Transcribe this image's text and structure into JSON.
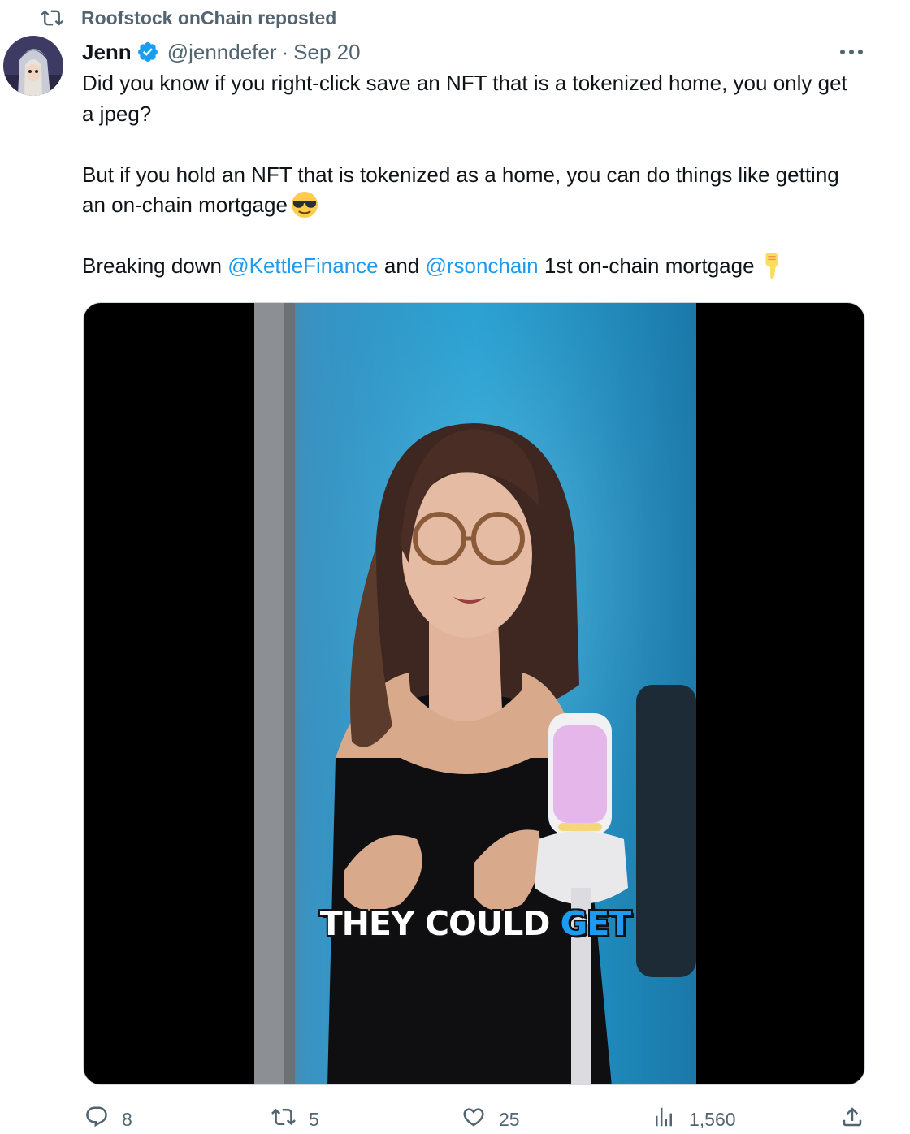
{
  "repost": {
    "text": "Roofstock onChain reposted",
    "icon": "repost-icon"
  },
  "tweet": {
    "author_name": "Jenn",
    "handle": "@jenndefer",
    "separator": "·",
    "date": "Sep 20",
    "verified_icon": "verified-badge-icon",
    "more_icon": "more-icon",
    "paragraph1": "Did you know if you right-click save an NFT that is a tokenized home, you only get a jpeg?",
    "paragraph2": "But if you hold an NFT that is tokenized as a home, you can do things like getting an on-chain mortgage",
    "paragraph3_prefix": "Breaking down",
    "mention1": "@KettleFinance",
    "paragraph3_mid": "and",
    "mention2": "@rsonchain",
    "paragraph3_suffix": "1st on-chain mortgage",
    "emoji1": "smiling-face-with-sunglasses-emoji",
    "emoji2": "backhand-index-pointing-down-emoji",
    "video": {
      "caption_white": "THEY COULD",
      "caption_highlight": "GET"
    }
  },
  "actions": {
    "replies": "8",
    "reposts": "5",
    "likes": "25",
    "views": "1,560"
  },
  "colors": {
    "accent": "#1d9bf0",
    "secondary_text": "#536471",
    "primary_text": "#0f1419",
    "media_background": "#000000"
  }
}
